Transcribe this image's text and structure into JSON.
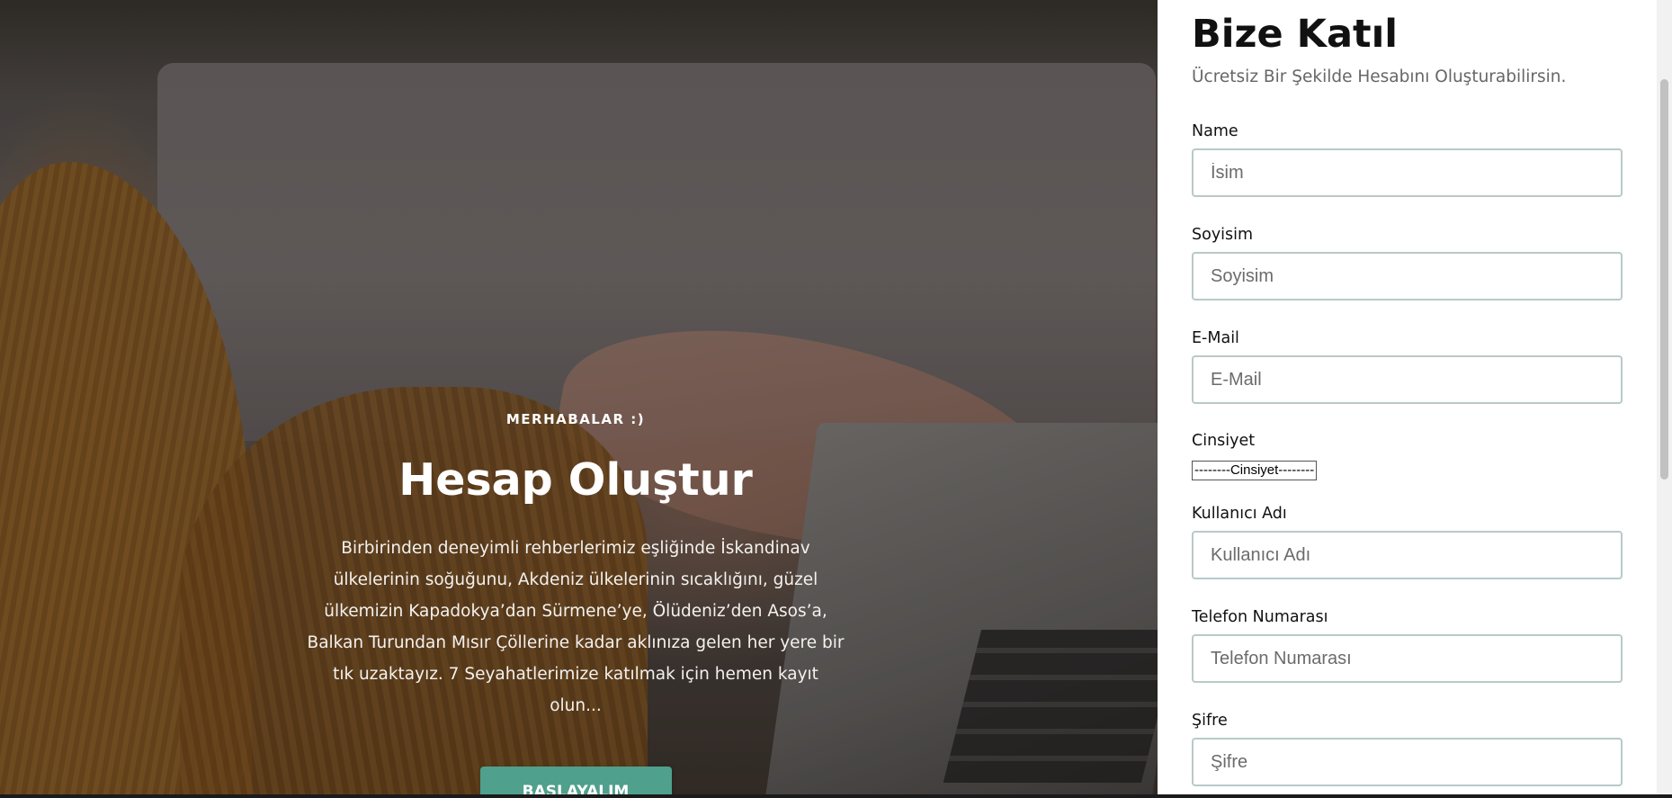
{
  "hero": {
    "eyebrow": "MERHABALAR :)",
    "title": "Hesap Oluştur",
    "description": "Birbirinden deneyimli rehberlerimiz eşliğinde İskandinav ülkelerinin soğuğunu, Akdeniz ülkelerinin sıcaklığını, güzel ülkemizin Kapadokya’dan Sürmene’ye, Ölüdeniz’den Asos’a, Balkan Turundan Mısır Çöllerine kadar aklınıza gelen her yere bir tık uzaktayız. 7 Seyahatlerimize katılmak için hemen kayıt olun...",
    "cta_label": "BAŞLAYALIM"
  },
  "form": {
    "title": "Bize Katıl",
    "subtitle": "Ücretsiz Bir Şekilde Hesabını Oluşturabilirsin.",
    "name": {
      "label": "Name",
      "placeholder": "İsim"
    },
    "surname": {
      "label": "Soyisim",
      "placeholder": "Soyisim"
    },
    "email": {
      "label": "E-Mail",
      "placeholder": "E-Mail"
    },
    "gender": {
      "label": "Cinsiyet",
      "selected": "--------Cinsiyet--------"
    },
    "username": {
      "label": "Kullanıcı Adı",
      "placeholder": "Kullanıcı Adı"
    },
    "phone": {
      "label": "Telefon Numarası",
      "placeholder": "Telefon Numarası"
    },
    "password": {
      "label": "Şifre",
      "placeholder": "Şifre"
    }
  },
  "colors": {
    "accent": "#4fa08c",
    "input_border": "#b9c9c8"
  }
}
